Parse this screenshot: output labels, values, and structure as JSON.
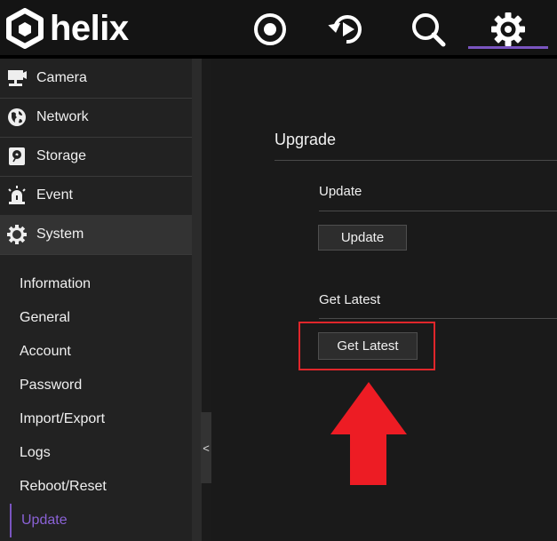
{
  "header": {
    "logo_text": "helix",
    "nav_icons": [
      "live-view-icon",
      "playback-icon",
      "search-icon",
      "settings-gear-icon"
    ],
    "active_nav": "settings-gear-icon",
    "accent_color": "#7a55c0"
  },
  "sidebar": {
    "items": [
      {
        "label": "Camera",
        "icon": "camera-icon"
      },
      {
        "label": "Network",
        "icon": "globe-icon"
      },
      {
        "label": "Storage",
        "icon": "hard-drive-icon"
      },
      {
        "label": "Event",
        "icon": "alarm-siren-icon"
      },
      {
        "label": "System",
        "icon": "gear-icon"
      }
    ],
    "active_item": "System",
    "subitems": [
      "Information",
      "General",
      "Account",
      "Password",
      "Import/Export",
      "Logs",
      "Reboot/Reset",
      "Update"
    ],
    "active_subitem": "Update",
    "collapse_label": "<"
  },
  "main": {
    "section_title": "Upgrade",
    "update": {
      "title": "Update",
      "button_label": "Update"
    },
    "get_latest": {
      "title": "Get Latest",
      "button_label": "Get Latest"
    }
  },
  "annotation": {
    "highlight_color": "#e0262b",
    "arrow_color": "#ed1c24"
  }
}
